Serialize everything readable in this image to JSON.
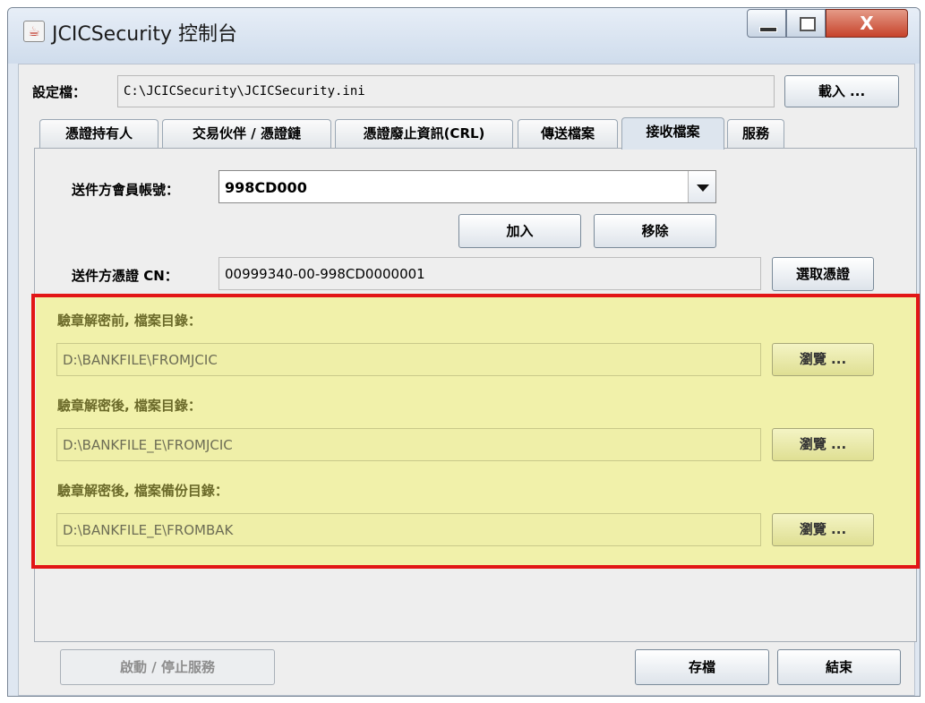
{
  "window": {
    "title": "JCICSecurity 控制台",
    "close_glyph": "X",
    "app_icon_glyph": "☕"
  },
  "config": {
    "label": "設定檔：",
    "path": "C:\\JCICSecurity\\JCICSecurity.ini",
    "load_button": "載入 ..."
  },
  "tabs": [
    {
      "label": "憑證持有人",
      "active": false
    },
    {
      "label": "交易伙伴 / 憑證鏈",
      "active": false
    },
    {
      "label": "憑證廢止資訊(CRL)",
      "active": false
    },
    {
      "label": "傳送檔案",
      "active": false
    },
    {
      "label": "接收檔案",
      "active": true
    },
    {
      "label": "服務",
      "active": false
    }
  ],
  "receive": {
    "sender_id_label": "送件方會員帳號：",
    "sender_id_value": "998CD000",
    "add_button": "加入",
    "remove_button": "移除",
    "cert_label": "送件方憑證 CN：",
    "cert_value": "00999340-00-998CD0000001",
    "select_cert_button": "選取憑證",
    "dirs": [
      {
        "label": "驗章解密前, 檔案目錄：",
        "value": "D:\\BANKFILE\\FROMJCIC",
        "button": "瀏覽 ..."
      },
      {
        "label": "驗章解密後, 檔案目錄：",
        "value": "D:\\BANKFILE_E\\FROMJCIC",
        "button": "瀏覽 ..."
      },
      {
        "label": "驗章解密後, 檔案備份目錄：",
        "value": "D:\\BANKFILE_E\\FROMBAK",
        "button": "瀏覽 ..."
      }
    ]
  },
  "footer": {
    "service_button": "啟動 / 停止服務",
    "save_button": "存檔",
    "exit_button": "結束"
  },
  "colors": {
    "highlight_fill": "#f1f1aa",
    "highlight_border": "#e21616"
  }
}
